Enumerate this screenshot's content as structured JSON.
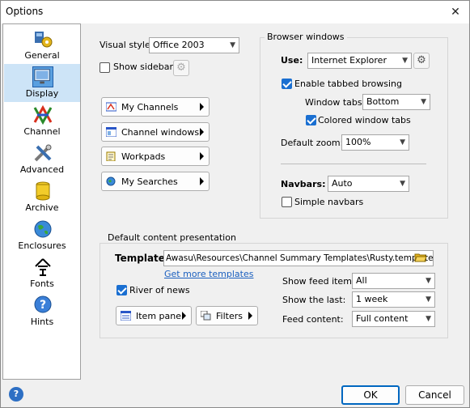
{
  "window": {
    "title": "Options"
  },
  "sidebar": {
    "items": [
      {
        "label": "General",
        "icon": "general-icon"
      },
      {
        "label": "Display",
        "icon": "monitor-icon"
      },
      {
        "label": "Channel",
        "icon": "channel-icon"
      },
      {
        "label": "Advanced",
        "icon": "tools-icon"
      },
      {
        "label": "Archive",
        "icon": "archive-icon"
      },
      {
        "label": "Enclosures",
        "icon": "globe-icon"
      },
      {
        "label": "Fonts",
        "icon": "font-icon"
      },
      {
        "label": "Hints",
        "icon": "hints-icon"
      }
    ],
    "selected": "Display"
  },
  "display": {
    "visual_style_label": "Visual style:",
    "visual_style_value": "Office 2003",
    "show_sidebar_label": "Show sidebar",
    "show_sidebar_checked": false,
    "buttons": {
      "my_channels": "My Channels",
      "channel_windows": "Channel windows",
      "workpads": "Workpads",
      "my_searches": "My Searches"
    }
  },
  "browser": {
    "group_title": "Browser windows",
    "use_label": "Use:",
    "use_value": "Internet Explorer",
    "tabbed_label": "Enable tabbed browsing",
    "tabbed_checked": true,
    "window_tabs_label": "Window tabs:",
    "window_tabs_value": "Bottom",
    "colored_tabs_label": "Colored window tabs",
    "colored_tabs_checked": true,
    "zoom_label": "Default zoom:",
    "zoom_value": "100%",
    "navbars_label": "Navbars:",
    "navbars_value": "Auto",
    "simple_navbars_label": "Simple navbars",
    "simple_navbars_checked": false
  },
  "presentation": {
    "group_title": "Default content presentation",
    "template_label": "Template:",
    "template_value": "Awasu\\Resources\\Channel Summary Templates\\Rusty.template",
    "more_templates_link": "Get more templates",
    "river_label": "River of news",
    "river_checked": true,
    "item_pane_label": "Item pane",
    "filters_label": "Filters",
    "feed_items_label": "Show feed items:",
    "feed_items_value": "All",
    "show_last_label": "Show the last:",
    "show_last_value": "1 week",
    "feed_content_label": "Feed content:",
    "feed_content_value": "Full content"
  },
  "footer": {
    "ok": "OK",
    "cancel": "Cancel"
  },
  "colors": {
    "accent": "#0067c0",
    "selection": "#cde4f7",
    "link": "#1a5fbf"
  }
}
